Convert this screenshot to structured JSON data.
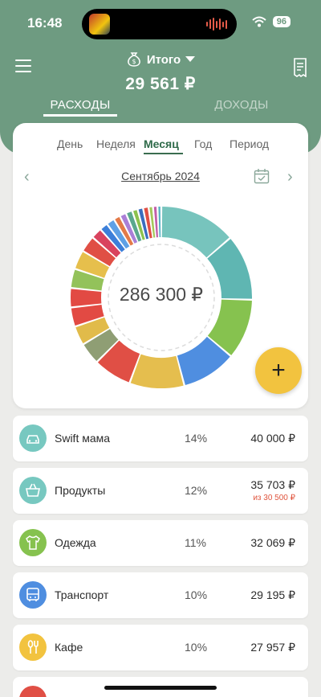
{
  "status": {
    "time": "16:48",
    "battery": "96"
  },
  "header": {
    "total_label": "Итого",
    "total_value": "29 561 ₽",
    "tab_expenses": "РАСХОДЫ",
    "tab_income": "ДОХОДЫ"
  },
  "period": {
    "tabs": [
      "День",
      "Неделя",
      "Месяц",
      "Год",
      "Период"
    ],
    "active": "Месяц",
    "month": "Сентябрь 2024",
    "prev": "‹",
    "next": "›"
  },
  "donut": {
    "center": "286 300 ₽",
    "segments": [
      {
        "color": "#77c4bd",
        "fraction": 0.14
      },
      {
        "color": "#5fb6b2",
        "fraction": 0.12
      },
      {
        "color": "#86c24f",
        "fraction": 0.11
      },
      {
        "color": "#4f8ee0",
        "fraction": 0.1
      },
      {
        "color": "#e5be4e",
        "fraction": 0.1
      },
      {
        "color": "#e04f45",
        "fraction": 0.07
      },
      {
        "color": "#8f9e74",
        "fraction": 0.04
      },
      {
        "color": "#e1bb4a",
        "fraction": 0.035
      },
      {
        "color": "#e24a43",
        "fraction": 0.035
      },
      {
        "color": "#e24a43",
        "fraction": 0.035
      },
      {
        "color": "#93c25a",
        "fraction": 0.035
      },
      {
        "color": "#e6bf4c",
        "fraction": 0.035
      },
      {
        "color": "#e04f45",
        "fraction": 0.03
      },
      {
        "color": "#d9435e",
        "fraction": 0.02
      },
      {
        "color": "#3c7fd9",
        "fraction": 0.015
      },
      {
        "color": "#5ea0e5",
        "fraction": 0.015
      },
      {
        "color": "#e37a48",
        "fraction": 0.012
      },
      {
        "color": "#aa7fd7",
        "fraction": 0.012
      },
      {
        "color": "#5aa88e",
        "fraction": 0.012
      },
      {
        "color": "#8cc24e",
        "fraction": 0.01
      },
      {
        "color": "#3a6dbf",
        "fraction": 0.01
      },
      {
        "color": "#e04f45",
        "fraction": 0.01
      },
      {
        "color": "#a4c85a",
        "fraction": 0.008
      },
      {
        "color": "#c25ea8",
        "fraction": 0.008
      },
      {
        "color": "#59b4c4",
        "fraction": 0.007
      }
    ]
  },
  "fab": {
    "label": "+"
  },
  "categories": [
    {
      "name": "Swift мама",
      "percent": "14%",
      "amount": "40 000 ₽",
      "limit": "",
      "color": "#77c8c0",
      "icon": "car-icon"
    },
    {
      "name": "Продукты",
      "percent": "12%",
      "amount": "35 703 ₽",
      "limit": "из 30 500 ₽",
      "color": "#77c8c0",
      "icon": "basket-icon"
    },
    {
      "name": "Одежда",
      "percent": "11%",
      "amount": "32 069 ₽",
      "limit": "",
      "color": "#86c24f",
      "icon": "shirt-icon"
    },
    {
      "name": "Транспорт",
      "percent": "10%",
      "amount": "29 195 ₽",
      "limit": "",
      "color": "#4f8ee0",
      "icon": "bus-icon"
    },
    {
      "name": "Кафе",
      "percent": "10%",
      "amount": "27 957 ₽",
      "limit": "",
      "color": "#f2c33f",
      "icon": "cutlery-icon"
    }
  ]
}
